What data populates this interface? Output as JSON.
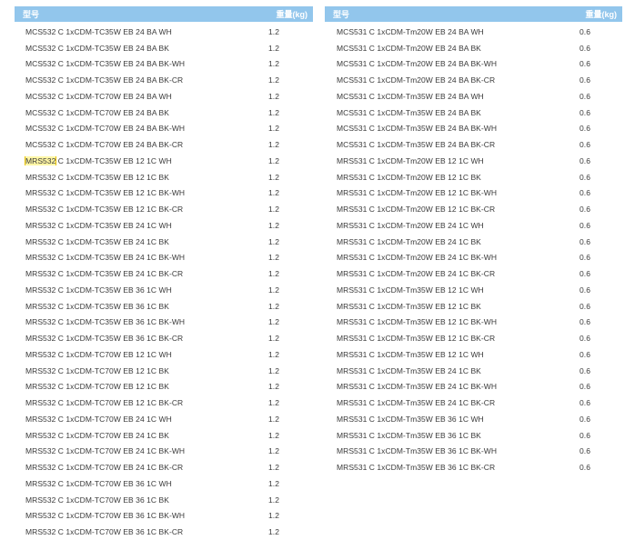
{
  "headers": {
    "model": "型号",
    "weight": "重量(kg)"
  },
  "colors": {
    "header_bg": "#92c6ec",
    "highlight": "#fff6a6"
  },
  "left": {
    "rows": [
      {
        "model": "MCS532 C 1xCDM-TC35W EB 24 BA WH",
        "weight": "1.2"
      },
      {
        "model": "MCS532 C 1xCDM-TC35W EB 24 BA BK",
        "weight": "1.2"
      },
      {
        "model": "MCS532 C 1xCDM-TC35W EB 24 BA BK-WH",
        "weight": "1.2"
      },
      {
        "model": "MCS532 C 1xCDM-TC35W EB 24 BA BK-CR",
        "weight": "1.2"
      },
      {
        "model": "MCS532 C 1xCDM-TC70W EB 24 BA WH",
        "weight": "1.2"
      },
      {
        "model": "MCS532 C 1xCDM-TC70W EB 24 BA BK",
        "weight": "1.2"
      },
      {
        "model": "MCS532 C 1xCDM-TC70W EB 24 BA BK-WH",
        "weight": "1.2"
      },
      {
        "model": "MCS532 C 1xCDM-TC70W EB 24 BA BK-CR",
        "weight": "1.2"
      },
      {
        "model_hl": "MRS532",
        "model_rest": " C 1xCDM-TC35W EB 12 1C WH",
        "weight": "1.2"
      },
      {
        "model": "MRS532 C 1xCDM-TC35W EB 12 1C BK",
        "weight": "1.2"
      },
      {
        "model": "MRS532 C 1xCDM-TC35W EB 12 1C BK-WH",
        "weight": "1.2"
      },
      {
        "model": "MRS532 C 1xCDM-TC35W EB 12 1C BK-CR",
        "weight": "1.2"
      },
      {
        "model": "MRS532 C 1xCDM-TC35W EB 24 1C WH",
        "weight": "1.2"
      },
      {
        "model": "MRS532 C 1xCDM-TC35W EB 24 1C BK",
        "weight": "1.2"
      },
      {
        "model": "MRS532 C 1xCDM-TC35W EB 24 1C BK-WH",
        "weight": "1.2"
      },
      {
        "model": "MRS532 C 1xCDM-TC35W EB 24 1C BK-CR",
        "weight": "1.2"
      },
      {
        "model": "MRS532 C 1xCDM-TC35W EB 36 1C WH",
        "weight": "1.2"
      },
      {
        "model": "MRS532 C 1xCDM-TC35W EB 36 1C BK",
        "weight": "1.2"
      },
      {
        "model": "MRS532 C 1xCDM-TC35W EB 36 1C BK-WH",
        "weight": "1.2"
      },
      {
        "model": "MRS532 C 1xCDM-TC35W EB 36 1C BK-CR",
        "weight": "1.2"
      },
      {
        "model": "MRS532 C 1xCDM-TC70W EB 12 1C WH",
        "weight": "1.2"
      },
      {
        "model": "MRS532 C 1xCDM-TC70W EB 12 1C BK",
        "weight": "1.2"
      },
      {
        "model": "MRS532 C 1xCDM-TC70W EB 12 1C BK",
        "weight": "1.2"
      },
      {
        "model": "MRS532 C 1xCDM-TC70W EB 12 1C BK-CR",
        "weight": "1.2"
      },
      {
        "model": "MRS532 C 1xCDM-TC70W EB 24 1C WH",
        "weight": "1.2"
      },
      {
        "model": "MRS532 C 1xCDM-TC70W EB 24 1C BK",
        "weight": "1.2"
      },
      {
        "model": "MRS532 C 1xCDM-TC70W EB 24 1C BK-WH",
        "weight": "1.2"
      },
      {
        "model": "MRS532 C 1xCDM-TC70W EB 24 1C BK-CR",
        "weight": "1.2"
      },
      {
        "model": "MRS532 C 1xCDM-TC70W EB 36 1C WH",
        "weight": "1.2"
      },
      {
        "model": "MRS532 C 1xCDM-TC70W EB 36 1C BK",
        "weight": "1.2"
      },
      {
        "model": "MRS532 C 1xCDM-TC70W EB 36 1C BK-WH",
        "weight": "1.2"
      },
      {
        "model": "MRS532 C 1xCDM-TC70W EB 36 1C BK-CR",
        "weight": "1.2"
      }
    ]
  },
  "right": {
    "rows": [
      {
        "model": "MCS531 C 1xCDM-Tm20W EB 24 BA WH",
        "weight": "0.6"
      },
      {
        "model": "MCS531 C 1xCDM-Tm20W EB 24 BA BK",
        "weight": "0.6"
      },
      {
        "model": "MCS531 C 1xCDM-Tm20W EB 24 BA BK-WH",
        "weight": "0.6"
      },
      {
        "model": "MCS531 C 1xCDM-Tm20W EB 24 BA BK-CR",
        "weight": "0.6"
      },
      {
        "model": "MCS531 C 1xCDM-Tm35W EB 24 BA WH",
        "weight": "0.6"
      },
      {
        "model": "MCS531 C 1xCDM-Tm35W EB 24 BA BK",
        "weight": "0.6"
      },
      {
        "model": "MCS531 C 1xCDM-Tm35W EB 24 BA BK-WH",
        "weight": "0.6"
      },
      {
        "model": "MCS531 C 1xCDM-Tm35W EB 24 BA BK-CR",
        "weight": "0.6"
      },
      {
        "model": "MRS531 C 1xCDM-Tm20W EB 12 1C WH",
        "weight": "0.6"
      },
      {
        "model": "MRS531 C 1xCDM-Tm20W EB 12 1C BK",
        "weight": "0.6"
      },
      {
        "model": "MRS531 C 1xCDM-Tm20W EB 12 1C BK-WH",
        "weight": "0.6"
      },
      {
        "model": "MRS531 C 1xCDM-Tm20W EB 12 1C BK-CR",
        "weight": "0.6"
      },
      {
        "model": "MRS531 C 1xCDM-Tm20W EB 24 1C WH",
        "weight": "0.6"
      },
      {
        "model": "MRS531 C 1xCDM-Tm20W EB 24 1C BK",
        "weight": "0.6"
      },
      {
        "model": "MRS531 C 1xCDM-Tm20W EB 24 1C BK-WH",
        "weight": "0.6"
      },
      {
        "model": "MRS531 C 1xCDM-Tm20W EB 24 1C BK-CR",
        "weight": "0.6"
      },
      {
        "model": "MRS531 C 1xCDM-Tm35W EB 12 1C WH",
        "weight": "0.6"
      },
      {
        "model": "MRS531 C 1xCDM-Tm35W EB 12 1C BK",
        "weight": "0.6"
      },
      {
        "model": "MRS531 C 1xCDM-Tm35W EB 12 1C BK-WH",
        "weight": "0.6"
      },
      {
        "model": "MRS531 C 1xCDM-Tm35W EB 12 1C BK-CR",
        "weight": "0.6"
      },
      {
        "model": "MRS531 C 1xCDM-Tm35W EB 12 1C WH",
        "weight": "0.6"
      },
      {
        "model": "MRS531 C 1xCDM-Tm35W EB 24 1C BK",
        "weight": "0.6"
      },
      {
        "model": "MRS531 C 1xCDM-Tm35W EB 24 1C BK-WH",
        "weight": "0.6"
      },
      {
        "model": "MRS531 C 1xCDM-Tm35W EB 24 1C BK-CR",
        "weight": "0.6"
      },
      {
        "model": "MRS531 C 1xCDM-Tm35W EB 36 1C WH",
        "weight": "0.6"
      },
      {
        "model": "MRS531 C 1xCDM-Tm35W EB 36 1C BK",
        "weight": "0.6"
      },
      {
        "model": "MRS531 C 1xCDM-Tm35W EB 36 1C BK-WH",
        "weight": "0.6"
      },
      {
        "model": "MRS531 C 1xCDM-Tm35W EB 36 1C BK-CR",
        "weight": "0.6"
      }
    ]
  }
}
